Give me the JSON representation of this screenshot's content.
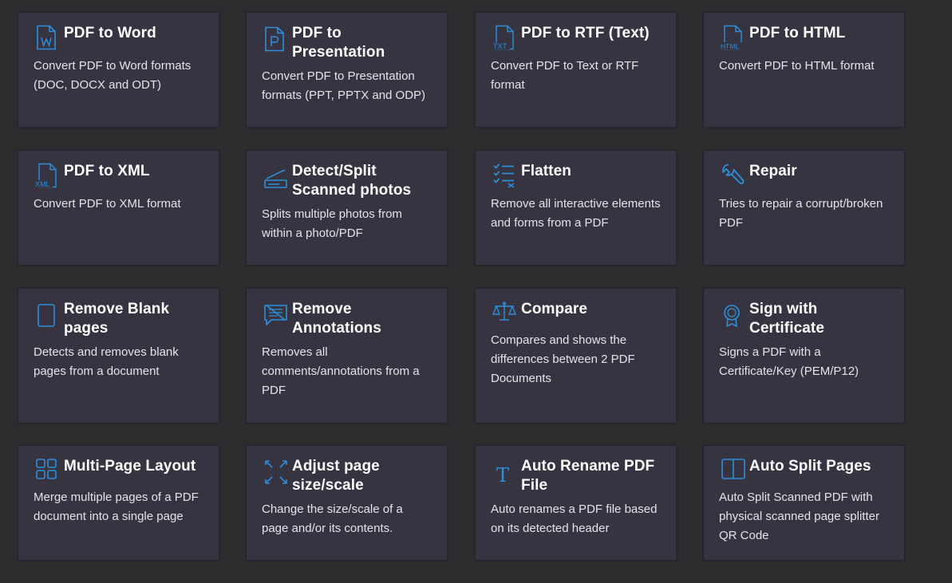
{
  "colors": {
    "page_bg": "#2d2d2f",
    "card_bg": "#353440",
    "card_border": "#26262c",
    "icon_accent": "#2f8fd8",
    "title_text": "#ffffff",
    "desc_text": "#e4e4ea"
  },
  "tools": [
    {
      "id": "pdf-to-word",
      "icon": "word-file-icon",
      "title": "PDF to Word",
      "desc": "Convert PDF to Word formats (DOC, DOCX and ODT)"
    },
    {
      "id": "pdf-to-presentation",
      "icon": "presentation-file-icon",
      "title": "PDF to Presentation",
      "desc": "Convert PDF to Presentation formats (PPT, PPTX and ODP)"
    },
    {
      "id": "pdf-to-rtf",
      "icon": "txt-file-icon",
      "title": "PDF to RTF (Text)",
      "desc": "Convert PDF to Text or RTF format"
    },
    {
      "id": "pdf-to-html",
      "icon": "html-file-icon",
      "title": "PDF to HTML",
      "desc": "Convert PDF to HTML format"
    },
    {
      "id": "pdf-to-xml",
      "icon": "xml-file-icon",
      "title": "PDF to XML",
      "desc": "Convert PDF to XML format"
    },
    {
      "id": "detect-split-scanned",
      "icon": "scanner-icon",
      "title": "Detect/Split Scanned photos",
      "desc": "Splits multiple photos from within a photo/PDF"
    },
    {
      "id": "flatten",
      "icon": "checklist-icon",
      "title": "Flatten",
      "desc": "Remove all interactive elements and forms from a PDF"
    },
    {
      "id": "repair",
      "icon": "wrench-icon",
      "title": "Repair",
      "desc": "Tries to repair a corrupt/broken PDF"
    },
    {
      "id": "remove-blank-pages",
      "icon": "blank-page-icon",
      "title": "Remove Blank pages",
      "desc": "Detects and removes blank pages from a document"
    },
    {
      "id": "remove-annotations",
      "icon": "comment-strike-icon",
      "title": "Remove Annotations",
      "desc": "Removes all comments/annotations from a PDF"
    },
    {
      "id": "compare",
      "icon": "scales-icon",
      "title": "Compare",
      "desc": "Compares and shows the differences between 2 PDF Documents"
    },
    {
      "id": "sign-with-certificate",
      "icon": "award-icon",
      "title": "Sign with Certificate",
      "desc": "Signs a PDF with a Certificate/Key (PEM/P12)"
    },
    {
      "id": "multi-page-layout",
      "icon": "grid-layout-icon",
      "title": "Multi-Page Layout",
      "desc": "Merge multiple pages of a PDF document into a single page"
    },
    {
      "id": "adjust-page-scale",
      "icon": "expand-arrows-icon",
      "title": "Adjust page size/scale",
      "desc": "Change the size/scale of a page and/or its contents."
    },
    {
      "id": "auto-rename",
      "icon": "text-t-icon",
      "title": "Auto Rename PDF File",
      "desc": "Auto renames a PDF file based on its detected header"
    },
    {
      "id": "auto-split-pages",
      "icon": "split-page-icon",
      "title": "Auto Split Pages",
      "desc": "Auto Split Scanned PDF with physical scanned page splitter QR Code"
    }
  ]
}
